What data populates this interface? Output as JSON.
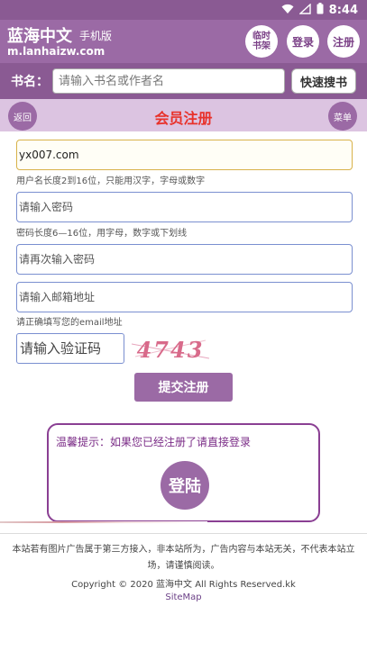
{
  "status_bar": {
    "time": "8:44"
  },
  "header": {
    "site_name": "蓝海中文",
    "site_sub": "手机版",
    "domain": "m.lanhaizw.com",
    "buttons": {
      "shelf_line1": "临时",
      "shelf_line2": "书架",
      "login": "登录",
      "register": "注册"
    }
  },
  "search": {
    "label": "书名：",
    "placeholder": "请输入书名或作者名",
    "button": "快速搜书"
  },
  "titlebar": {
    "back": "返回",
    "title": "会员注册",
    "menu": "菜单"
  },
  "form": {
    "username_value": "yx007.com",
    "username_hint": "用户名长度2到16位，只能用汉字，字母或数字",
    "password_placeholder": "请输入密码",
    "password_hint": "密码长度6—16位，用字母，数字或下划线",
    "password2_placeholder": "请再次输入密码",
    "email_placeholder": "请输入邮箱地址",
    "email_hint": "请正确填写您的email地址",
    "captcha_placeholder": "请输入验证码",
    "captcha_code": "4743",
    "submit": "提交注册"
  },
  "tip": {
    "text": "温馨提示：如果您已经注册了请直接登录",
    "login_button": "登陆"
  },
  "footer": {
    "notice": "本站若有图片广告属于第三方接入，非本站所为，广告内容与本站无关，不代表本站立场，请谨慎阅读。",
    "copyright": "Copyright © 2020 蓝海中文 All Rights Reserved.kk",
    "sitemap": "SiteMap"
  },
  "colors": {
    "header": "#9b6aa5",
    "title": "#e8322b",
    "captcha": "#d86a8a"
  }
}
